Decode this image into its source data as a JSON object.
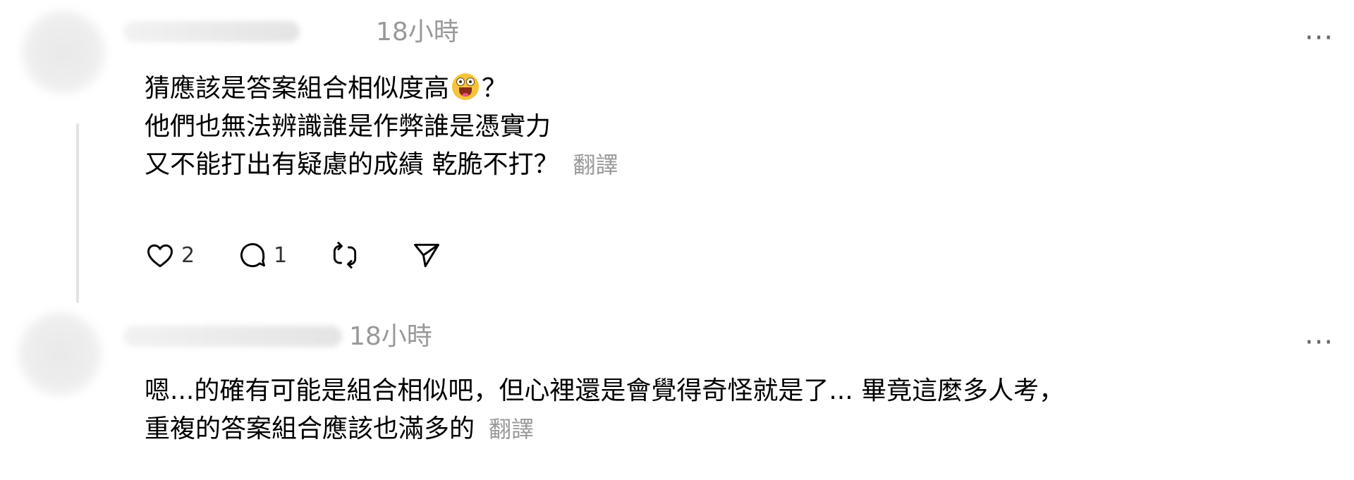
{
  "comments": [
    {
      "timestamp": "18小時",
      "lines": [
        "猜應該是答案組合相似度高",
        "？",
        "他們也無法辨識誰是作弊誰是憑實力",
        "又不能打出有疑慮的成績 乾脆不打？"
      ],
      "translate_label": "翻譯",
      "emoji": "zany-face-emoji",
      "actions": {
        "like": {
          "icon": "heart-icon",
          "count": "2"
        },
        "reply": {
          "icon": "comment-icon",
          "count": "1"
        },
        "repost": {
          "icon": "repost-icon"
        },
        "share": {
          "icon": "send-icon"
        }
      },
      "more_icon": "more-icon"
    },
    {
      "timestamp": "18小時",
      "lines": [
        "嗯...的確有可能是組合相似吧，但心裡還是會覺得奇怪就是了... 畢竟這麼多人考，",
        "重複的答案組合應該也滿多的"
      ],
      "translate_label": "翻譯",
      "more_icon": "more-icon"
    }
  ],
  "more_glyph": "···",
  "colors": {
    "text": "#000000",
    "muted": "#999999",
    "thread_line": "#e4e4e4"
  }
}
